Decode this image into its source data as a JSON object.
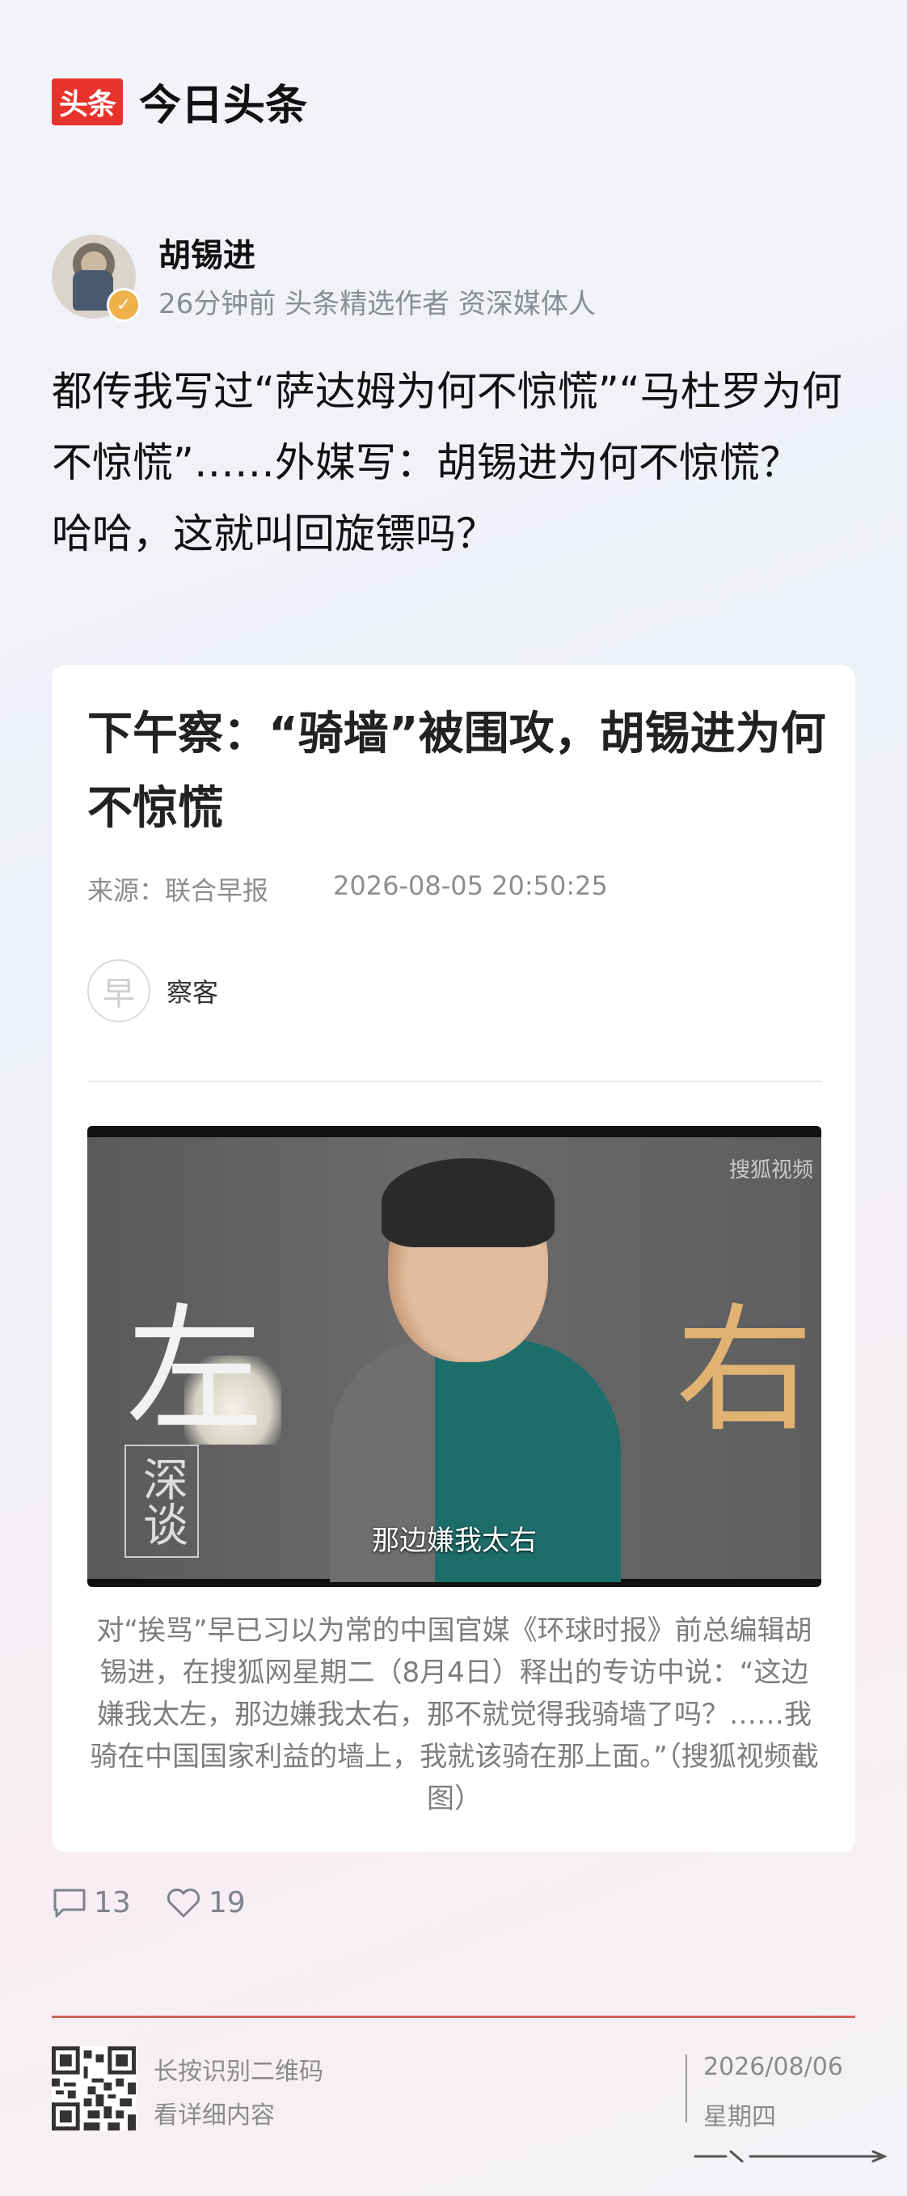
{
  "app": {
    "logo_text": "头条",
    "name": "今日头条",
    "brand_color": "#e8322c"
  },
  "author": {
    "name": "胡锡进",
    "meta": "26分钟前 头条精选作者 资深媒体人"
  },
  "post": {
    "text": "都传我写过“萨达姆为何不惊慌”“马杜罗为何不惊慌”……外媒写：胡锡进为何不惊慌？",
    "text2": "哈哈，这就叫回旋镖吗？"
  },
  "card": {
    "title": "下午察：“骑墙”被围攻，胡锡进为何不惊慌",
    "source": "来源：联合早报",
    "time": "2026-08-05 20:50:25",
    "author_logo": "早",
    "author_name": "察客",
    "video": {
      "char_left": "左",
      "char_right": "右",
      "deep_logo": "深谈",
      "watermark": "搜狐视频",
      "subtitle": "那边嫌我太右"
    },
    "caption": "对“挨骂”早已习以为常的中国官媒《环球时报》前总编辑胡锡进，在搜狐网星期二（8月4日）释出的专访中说：“这边嫌我太左，那边嫌我太右，那不就觉得我骑墙了吗？……我骑在中国国家利益的墙上，我就该骑在那上面。”（搜狐视频截图）"
  },
  "stats": {
    "comments": "13",
    "likes": "19"
  },
  "footer": {
    "line1": "长按识别二维码",
    "line2": "看详细内容",
    "date": "2026/08/06",
    "weekday": "星期四",
    "accent": "#d2625a"
  }
}
